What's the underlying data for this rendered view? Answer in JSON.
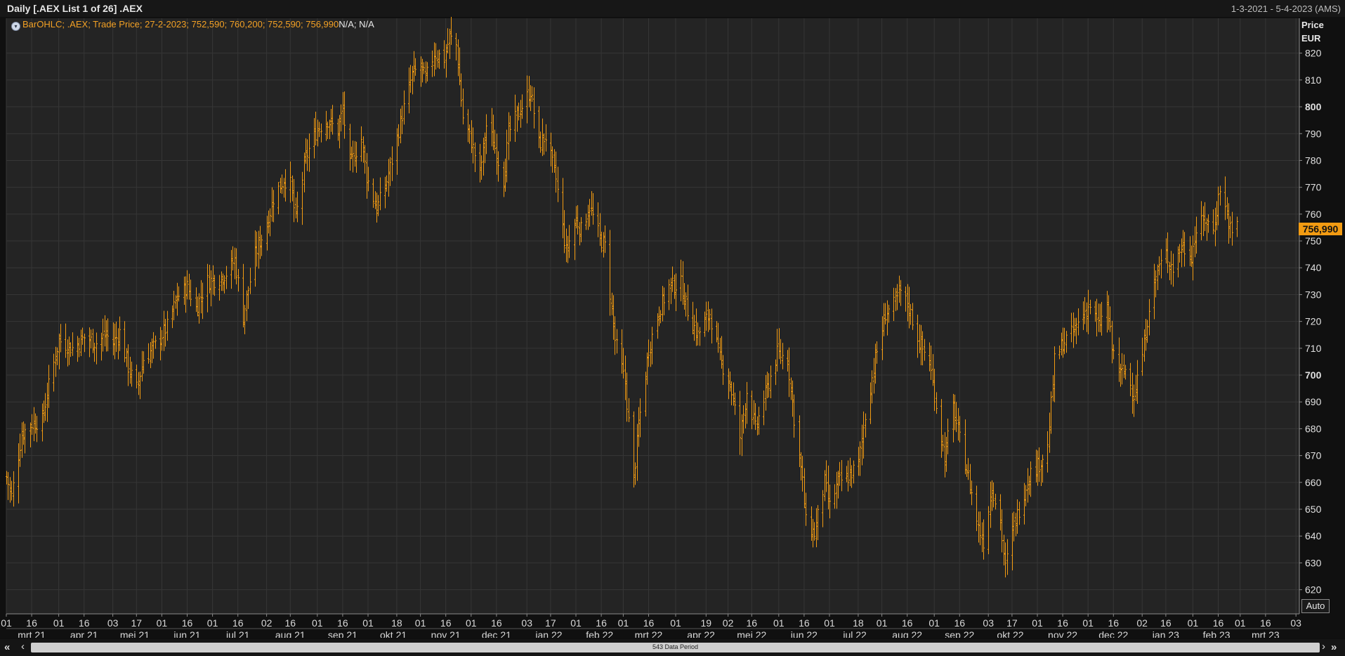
{
  "window": {
    "title": "Daily [.AEX List 1 of 26] .AEX",
    "range": "1-3-2021 - 5-4-2023 (AMS)"
  },
  "legend": {
    "text": "BarOHLC; .AEX; Trade Price; 27-2-2023; 752,590; 760,200; 752,590; 756,990",
    "extra": "N/A; N/A"
  },
  "y_axis": {
    "title_line1": "Price",
    "title_line2": "EUR"
  },
  "last_price_label": "756,990",
  "auto_button": "Auto",
  "scrollbar": {
    "label": "543 Data Period"
  },
  "colors": {
    "background": "#242424",
    "bars": "#f29b12",
    "grid": "#363636",
    "text": "#d9d9d9"
  },
  "chart_data": {
    "type": "bar",
    "subtype": "ohlc",
    "ylim": [
      611,
      833
    ],
    "y_ticks": [
      "620",
      "630",
      "640",
      "650",
      "660",
      "670",
      "680",
      "690",
      "700",
      "710",
      "720",
      "730",
      "740",
      "750",
      "760",
      "770",
      "780",
      "790",
      "800",
      "810",
      "820"
    ],
    "y_ticks_bold": [
      "700",
      "800"
    ],
    "x_range": [
      "2021-03-01",
      "2023-04-05"
    ],
    "x_ticks": [
      {
        "date": "2021-03-01",
        "label": "01"
      },
      {
        "date": "2021-03-16",
        "label": "16"
      },
      {
        "date": "2021-04-01",
        "label": "01"
      },
      {
        "date": "2021-04-16",
        "label": "16"
      },
      {
        "date": "2021-05-03",
        "label": "03"
      },
      {
        "date": "2021-05-17",
        "label": "17"
      },
      {
        "date": "2021-06-01",
        "label": "01"
      },
      {
        "date": "2021-06-16",
        "label": "16"
      },
      {
        "date": "2021-07-01",
        "label": "01"
      },
      {
        "date": "2021-07-16",
        "label": "16"
      },
      {
        "date": "2021-08-02",
        "label": "02"
      },
      {
        "date": "2021-08-16",
        "label": "16"
      },
      {
        "date": "2021-09-01",
        "label": "01"
      },
      {
        "date": "2021-09-16",
        "label": "16"
      },
      {
        "date": "2021-10-01",
        "label": "01"
      },
      {
        "date": "2021-10-18",
        "label": "18"
      },
      {
        "date": "2021-11-01",
        "label": "01"
      },
      {
        "date": "2021-11-16",
        "label": "16"
      },
      {
        "date": "2021-12-01",
        "label": "01"
      },
      {
        "date": "2021-12-16",
        "label": "16"
      },
      {
        "date": "2022-01-03",
        "label": "03"
      },
      {
        "date": "2022-01-17",
        "label": "17"
      },
      {
        "date": "2022-02-01",
        "label": "01"
      },
      {
        "date": "2022-02-16",
        "label": "16"
      },
      {
        "date": "2022-03-01",
        "label": "01"
      },
      {
        "date": "2022-03-16",
        "label": "16"
      },
      {
        "date": "2022-04-01",
        "label": "01"
      },
      {
        "date": "2022-04-19",
        "label": "19"
      },
      {
        "date": "2022-05-02",
        "label": "02"
      },
      {
        "date": "2022-05-16",
        "label": "16"
      },
      {
        "date": "2022-06-01",
        "label": "01"
      },
      {
        "date": "2022-06-16",
        "label": "16"
      },
      {
        "date": "2022-07-01",
        "label": "01"
      },
      {
        "date": "2022-07-18",
        "label": "18"
      },
      {
        "date": "2022-08-01",
        "label": "01"
      },
      {
        "date": "2022-08-16",
        "label": "16"
      },
      {
        "date": "2022-09-01",
        "label": "01"
      },
      {
        "date": "2022-09-16",
        "label": "16"
      },
      {
        "date": "2022-10-03",
        "label": "03"
      },
      {
        "date": "2022-10-17",
        "label": "17"
      },
      {
        "date": "2022-11-01",
        "label": "01"
      },
      {
        "date": "2022-11-16",
        "label": "16"
      },
      {
        "date": "2022-12-01",
        "label": "01"
      },
      {
        "date": "2022-12-16",
        "label": "16"
      },
      {
        "date": "2023-01-02",
        "label": "02"
      },
      {
        "date": "2023-01-16",
        "label": "16"
      },
      {
        "date": "2023-02-01",
        "label": "01"
      },
      {
        "date": "2023-02-16",
        "label": "16"
      },
      {
        "date": "2023-03-01",
        "label": "01"
      },
      {
        "date": "2023-03-16",
        "label": "16"
      },
      {
        "date": "2023-04-03",
        "label": "03"
      }
    ],
    "month_labels": [
      {
        "date": "2021-03-16",
        "label": "mrt 21"
      },
      {
        "date": "2021-04-16",
        "label": "apr 21"
      },
      {
        "date": "2021-05-16",
        "label": "mei 21"
      },
      {
        "date": "2021-06-16",
        "label": "jun 21"
      },
      {
        "date": "2021-07-16",
        "label": "jul 21"
      },
      {
        "date": "2021-08-16",
        "label": "aug 21"
      },
      {
        "date": "2021-09-16",
        "label": "sep 21"
      },
      {
        "date": "2021-10-16",
        "label": "okt 21"
      },
      {
        "date": "2021-11-16",
        "label": "nov 21"
      },
      {
        "date": "2021-12-16",
        "label": "dec 21"
      },
      {
        "date": "2022-01-16",
        "label": "jan 22"
      },
      {
        "date": "2022-02-15",
        "label": "feb 22"
      },
      {
        "date": "2022-03-16",
        "label": "mrt 22"
      },
      {
        "date": "2022-04-16",
        "label": "apr 22"
      },
      {
        "date": "2022-05-16",
        "label": "mei 22"
      },
      {
        "date": "2022-06-16",
        "label": "jun 22"
      },
      {
        "date": "2022-07-16",
        "label": "jul 22"
      },
      {
        "date": "2022-08-16",
        "label": "aug 22"
      },
      {
        "date": "2022-09-16",
        "label": "sep 22"
      },
      {
        "date": "2022-10-16",
        "label": "okt 22"
      },
      {
        "date": "2022-11-16",
        "label": "nov 22"
      },
      {
        "date": "2022-12-16",
        "label": "dec 22"
      },
      {
        "date": "2023-01-16",
        "label": "jan 23"
      },
      {
        "date": "2023-02-15",
        "label": "feb 23"
      },
      {
        "date": "2023-03-16",
        "label": "mrt 23"
      }
    ],
    "close_path": [
      {
        "date": "2021-03-01",
        "close": 662
      },
      {
        "date": "2021-03-04",
        "close": 655
      },
      {
        "date": "2021-03-10",
        "close": 678
      },
      {
        "date": "2021-03-16",
        "close": 682
      },
      {
        "date": "2021-03-22",
        "close": 683
      },
      {
        "date": "2021-03-26",
        "close": 696
      },
      {
        "date": "2021-04-01",
        "close": 713
      },
      {
        "date": "2021-04-09",
        "close": 710
      },
      {
        "date": "2021-04-16",
        "close": 714
      },
      {
        "date": "2021-04-23",
        "close": 712
      },
      {
        "date": "2021-04-29",
        "close": 715
      },
      {
        "date": "2021-05-03",
        "close": 712
      },
      {
        "date": "2021-05-07",
        "close": 716
      },
      {
        "date": "2021-05-12",
        "close": 703
      },
      {
        "date": "2021-05-17",
        "close": 695
      },
      {
        "date": "2021-05-21",
        "close": 706
      },
      {
        "date": "2021-05-28",
        "close": 711
      },
      {
        "date": "2021-06-04",
        "close": 718
      },
      {
        "date": "2021-06-10",
        "close": 729
      },
      {
        "date": "2021-06-16",
        "close": 733
      },
      {
        "date": "2021-06-21",
        "close": 725
      },
      {
        "date": "2021-06-28",
        "close": 735
      },
      {
        "date": "2021-07-05",
        "close": 736
      },
      {
        "date": "2021-07-09",
        "close": 738
      },
      {
        "date": "2021-07-14",
        "close": 743
      },
      {
        "date": "2021-07-19",
        "close": 722
      },
      {
        "date": "2021-07-26",
        "close": 745
      },
      {
        "date": "2021-08-02",
        "close": 756
      },
      {
        "date": "2021-08-06",
        "close": 766
      },
      {
        "date": "2021-08-12",
        "close": 773
      },
      {
        "date": "2021-08-16",
        "close": 771
      },
      {
        "date": "2021-08-19",
        "close": 758
      },
      {
        "date": "2021-08-25",
        "close": 781
      },
      {
        "date": "2021-09-01",
        "close": 792
      },
      {
        "date": "2021-09-07",
        "close": 795
      },
      {
        "date": "2021-09-13",
        "close": 791
      },
      {
        "date": "2021-09-16",
        "close": 799
      },
      {
        "date": "2021-09-20",
        "close": 778
      },
      {
        "date": "2021-09-27",
        "close": 788
      },
      {
        "date": "2021-09-30",
        "close": 774
      },
      {
        "date": "2021-10-06",
        "close": 762
      },
      {
        "date": "2021-10-11",
        "close": 770
      },
      {
        "date": "2021-10-15",
        "close": 780
      },
      {
        "date": "2021-10-21",
        "close": 797
      },
      {
        "date": "2021-10-27",
        "close": 812
      },
      {
        "date": "2021-11-01",
        "close": 815
      },
      {
        "date": "2021-11-04",
        "close": 810
      },
      {
        "date": "2021-11-09",
        "close": 820
      },
      {
        "date": "2021-11-15",
        "close": 818
      },
      {
        "date": "2021-11-18",
        "close": 826
      },
      {
        "date": "2021-11-22",
        "close": 823
      },
      {
        "date": "2021-11-26",
        "close": 796
      },
      {
        "date": "2021-12-01",
        "close": 787
      },
      {
        "date": "2021-12-06",
        "close": 775
      },
      {
        "date": "2021-12-10",
        "close": 793
      },
      {
        "date": "2021-12-14",
        "close": 787
      },
      {
        "date": "2021-12-20",
        "close": 773
      },
      {
        "date": "2021-12-23",
        "close": 790
      },
      {
        "date": "2021-12-29",
        "close": 798
      },
      {
        "date": "2022-01-05",
        "close": 806
      },
      {
        "date": "2022-01-10",
        "close": 786
      },
      {
        "date": "2022-01-14",
        "close": 789
      },
      {
        "date": "2022-01-20",
        "close": 773
      },
      {
        "date": "2022-01-26",
        "close": 746
      },
      {
        "date": "2022-02-01",
        "close": 758
      },
      {
        "date": "2022-02-04",
        "close": 754
      },
      {
        "date": "2022-02-09",
        "close": 763
      },
      {
        "date": "2022-02-15",
        "close": 751
      },
      {
        "date": "2022-02-18",
        "close": 748
      },
      {
        "date": "2022-02-24",
        "close": 713
      },
      {
        "date": "2022-03-02",
        "close": 697
      },
      {
        "date": "2022-03-07",
        "close": 661
      },
      {
        "date": "2022-03-10",
        "close": 681
      },
      {
        "date": "2022-03-16",
        "close": 710
      },
      {
        "date": "2022-03-22",
        "close": 724
      },
      {
        "date": "2022-03-28",
        "close": 733
      },
      {
        "date": "2022-04-04",
        "close": 734
      },
      {
        "date": "2022-04-08",
        "close": 724
      },
      {
        "date": "2022-04-14",
        "close": 715
      },
      {
        "date": "2022-04-21",
        "close": 723
      },
      {
        "date": "2022-04-27",
        "close": 706
      },
      {
        "date": "2022-05-03",
        "close": 697
      },
      {
        "date": "2022-05-09",
        "close": 677
      },
      {
        "date": "2022-05-13",
        "close": 694
      },
      {
        "date": "2022-05-18",
        "close": 680
      },
      {
        "date": "2022-05-24",
        "close": 693
      },
      {
        "date": "2022-05-31",
        "close": 708
      },
      {
        "date": "2022-06-06",
        "close": 706
      },
      {
        "date": "2022-06-10",
        "close": 684
      },
      {
        "date": "2022-06-15",
        "close": 660
      },
      {
        "date": "2022-06-17",
        "close": 645
      },
      {
        "date": "2022-06-22",
        "close": 641
      },
      {
        "date": "2022-06-28",
        "close": 660
      },
      {
        "date": "2022-07-01",
        "close": 651
      },
      {
        "date": "2022-07-06",
        "close": 660
      },
      {
        "date": "2022-07-12",
        "close": 662
      },
      {
        "date": "2022-07-18",
        "close": 667
      },
      {
        "date": "2022-07-22",
        "close": 685
      },
      {
        "date": "2022-07-28",
        "close": 706
      },
      {
        "date": "2022-08-03",
        "close": 723
      },
      {
        "date": "2022-08-08",
        "close": 726
      },
      {
        "date": "2022-08-12",
        "close": 731
      },
      {
        "date": "2022-08-17",
        "close": 725
      },
      {
        "date": "2022-08-23",
        "close": 712
      },
      {
        "date": "2022-08-29",
        "close": 705
      },
      {
        "date": "2022-09-02",
        "close": 689
      },
      {
        "date": "2022-09-07",
        "close": 669
      },
      {
        "date": "2022-09-12",
        "close": 688
      },
      {
        "date": "2022-09-16",
        "close": 676
      },
      {
        "date": "2022-09-22",
        "close": 659
      },
      {
        "date": "2022-09-27",
        "close": 643
      },
      {
        "date": "2022-09-30",
        "close": 638
      },
      {
        "date": "2022-10-05",
        "close": 659
      },
      {
        "date": "2022-10-10",
        "close": 645
      },
      {
        "date": "2022-10-13",
        "close": 628
      },
      {
        "date": "2022-10-17",
        "close": 642
      },
      {
        "date": "2022-10-21",
        "close": 650
      },
      {
        "date": "2022-10-27",
        "close": 663
      },
      {
        "date": "2022-11-02",
        "close": 667
      },
      {
        "date": "2022-11-07",
        "close": 673
      },
      {
        "date": "2022-11-11",
        "close": 705
      },
      {
        "date": "2022-11-16",
        "close": 712
      },
      {
        "date": "2022-11-22",
        "close": 716
      },
      {
        "date": "2022-11-28",
        "close": 723
      },
      {
        "date": "2022-12-02",
        "close": 726
      },
      {
        "date": "2022-12-07",
        "close": 718
      },
      {
        "date": "2022-12-12",
        "close": 726
      },
      {
        "date": "2022-12-15",
        "close": 710
      },
      {
        "date": "2022-12-20",
        "close": 700
      },
      {
        "date": "2022-12-23",
        "close": 702
      },
      {
        "date": "2022-12-28",
        "close": 693
      },
      {
        "date": "2023-01-03",
        "close": 711
      },
      {
        "date": "2023-01-06",
        "close": 726
      },
      {
        "date": "2023-01-11",
        "close": 739
      },
      {
        "date": "2023-01-16",
        "close": 745
      },
      {
        "date": "2023-01-20",
        "close": 740
      },
      {
        "date": "2023-01-25",
        "close": 748
      },
      {
        "date": "2023-01-31",
        "close": 745
      },
      {
        "date": "2023-02-03",
        "close": 754
      },
      {
        "date": "2023-02-08",
        "close": 758
      },
      {
        "date": "2023-02-13",
        "close": 754
      },
      {
        "date": "2023-02-17",
        "close": 770
      },
      {
        "date": "2023-02-22",
        "close": 757
      },
      {
        "date": "2023-02-24",
        "close": 752
      },
      {
        "date": "2023-02-27",
        "close": 757
      }
    ]
  }
}
